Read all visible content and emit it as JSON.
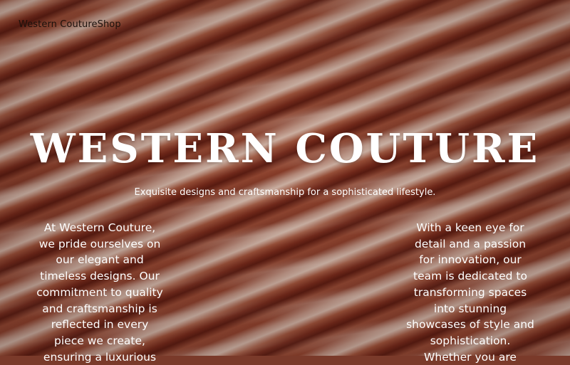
{
  "header": {
    "shop_name": "Western CoutureShop"
  },
  "hero": {
    "title": "WESTERN COUTURE",
    "subtitle": "Exquisite designs and craftsmanship for a sophisticated lifestyle."
  },
  "columns": {
    "left_text": "At Western Couture, we pride ourselves on our elegant and timeless designs. Our commitment to quality and craftsmanship is reflected in every piece we create, ensuring a luxurious",
    "right_text": "With a keen eye for detail and a passion for innovation, our team is dedicated to transforming spaces into stunning showcases of style and sophistication. Whether you are"
  },
  "colors": {
    "text_primary": "#ffffff",
    "header_text": "#1c100b",
    "background_dark": "#8a3f2c",
    "background_light": "#f5e4d6"
  }
}
